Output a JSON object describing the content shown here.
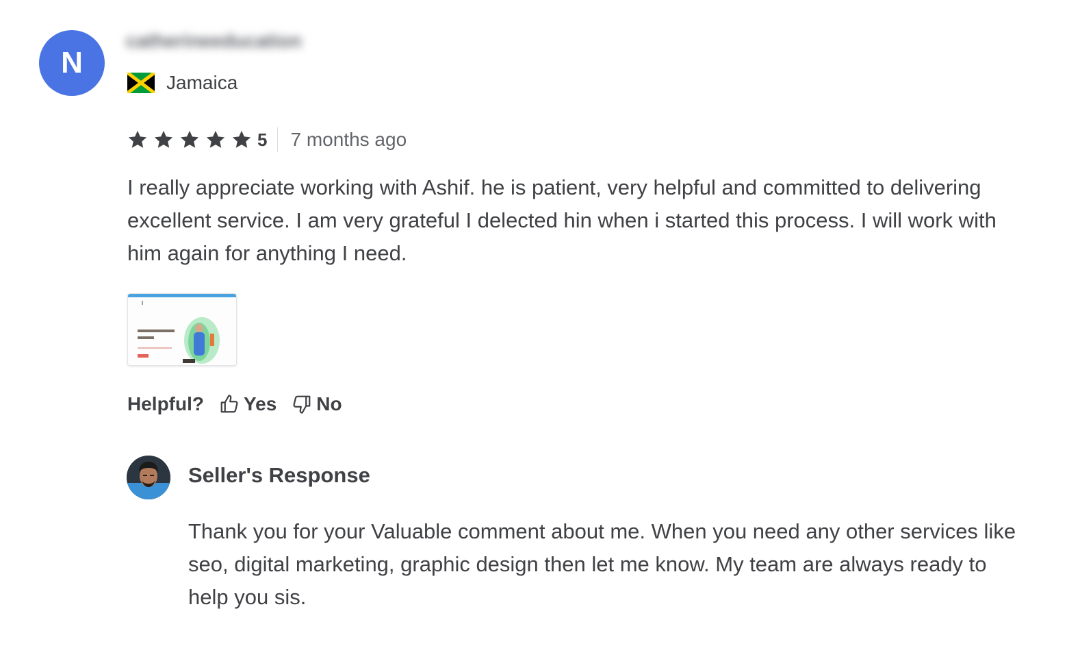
{
  "review": {
    "avatar_initial": "N",
    "avatar_color": "#4a74e4",
    "username_blurred": "catherineeducation",
    "country": "Jamaica",
    "country_flag": "jamaica-flag-icon",
    "rating": 5,
    "rating_label": "5",
    "time_ago": "7 months ago",
    "text": "I really appreciate working with Ashif. he is patient, very helpful and committed to delivering excellent service. I am very grateful I delected hin when i started this process. I will work with him again for anything I need.",
    "attachment_icon": "image-thumbnail"
  },
  "helpful": {
    "label": "Helpful?",
    "yes_label": "Yes",
    "no_label": "No",
    "yes_icon": "thumbs-up-icon",
    "no_icon": "thumbs-down-icon"
  },
  "seller_response": {
    "title": "Seller's Response",
    "text": "Thank you for your Valuable comment about me. When you need any other services like seo, digital marketing, graphic design then let me know. My team are always ready to help you sis."
  },
  "colors": {
    "text": "#404145",
    "secondary": "#62646a",
    "star": "#404145",
    "avatar": "#4a74e4"
  }
}
